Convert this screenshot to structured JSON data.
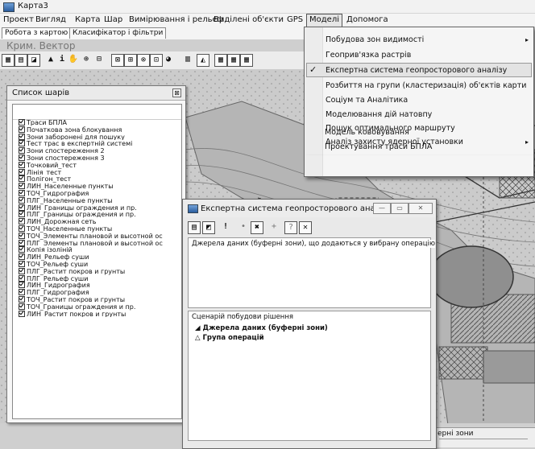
{
  "window": {
    "title": "Карта3"
  },
  "menu": [
    "Проект",
    "Вигляд",
    "Карта",
    "Шар",
    "Вимірювання і рельєф",
    "Виділені об'єкти",
    "GPS",
    "Моделі",
    "Допомога"
  ],
  "tabs": [
    "Робота з картою",
    "Класифікатор і фільтри"
  ],
  "doc_title": "Крим. Вектор",
  "toolbar": {
    "icons": [
      "grid-icon",
      "table-icon",
      "chart-icon",
      "pointer-icon",
      "info-icon",
      "hand-icon",
      "zoom-in-icon",
      "zoom-window-icon",
      "select-all-icon",
      "select-rect-icon",
      "select-cross-icon",
      "select-poly-icon",
      "globe-icon",
      "hatch-icon",
      "layers-icon",
      "table2-icon",
      "table3-icon",
      "table4-icon"
    ]
  },
  "layers_panel": {
    "title": "Список шарів",
    "close": "⊠",
    "items": [
      "Траси БПЛА",
      "Початкова зона блокування",
      "Зони заборонені для пошуку",
      "Тест трас в експертній системі",
      "Зони спостереження 2",
      "Зони спостереження 3",
      "Точковий_тест",
      "Лінія_тест",
      "Полігон_тест",
      "ЛИН_Населенные пункты",
      "ТОЧ_Гидрография",
      "ПЛГ_Населенные пункты",
      "ЛИН_Границы ограждения и пр.",
      "ПЛГ_Границы ограждения и пр.",
      "ЛИН_Дорожная сеть",
      "ТОЧ_Населенные пункты",
      "ТОЧ_Элементы плановой и высотной ос",
      "ПЛГ_Элементы плановой и высотной ос",
      "Копія ізоліній",
      "ЛИН_Рельеф суши",
      "ТОЧ_Рельеф суши",
      "ПЛГ_Растит покров и грунты",
      "ПЛГ_Рельеф суши",
      "ЛИН_Гидрография",
      "ПЛГ_Гидрография",
      "ТОЧ_Растит покров и грунты",
      "ТОЧ_Границы ограждения и пр.",
      "ЛИН_Растит покров и грунты"
    ]
  },
  "models_menu": {
    "items": [
      {
        "label": "Побудова зон видимості",
        "submenu": true,
        "checked": false
      },
      {
        "label": "Геоприв'язка растрів",
        "submenu": false,
        "checked": false
      },
      {
        "label": "Експертна система геопросторового аналізу",
        "submenu": false,
        "checked": true
      },
      {
        "label": "Розбиття на групи (кластеризація) об'єктів карти",
        "submenu": false,
        "checked": false
      },
      {
        "label": "Соціум та Аналітика",
        "submenu": false,
        "checked": false
      },
      {
        "label": "Моделювання дій натовпу",
        "submenu": false,
        "checked": false
      },
      {
        "label": "Пошук оптимального маршруту",
        "submenu": false,
        "checked": false
      },
      {
        "label": "Аналіз захисту ядерної установки",
        "submenu": true,
        "checked": false
      },
      {
        "label": "Модель кововування",
        "submenu": false,
        "checked": false
      },
      {
        "label": "Проектування траси БПЛА",
        "submenu": false,
        "checked": false
      }
    ],
    "submenu_arrow": "▸",
    "check_mark": "✓"
  },
  "expert_window": {
    "title": "Експертна система геопросторового аналізу",
    "buttons": {
      "minimize": "—",
      "maximize": "▭",
      "close": "✕"
    },
    "tools": [
      "sheet-icon",
      "save-icon",
      "exclamation-icon",
      "dot-icon",
      "cross-icon",
      "plus-icon",
      "help-icon",
      "x-icon"
    ],
    "sources_label": "Джерела даних (буферні зони), що додаються у вибрану операцію",
    "scenario_label": "Сценарій побудови рішення",
    "tree": [
      "Джерела даних (буферні зони)",
      "Група операцій"
    ]
  },
  "map_fragment_label": "ерні зони"
}
